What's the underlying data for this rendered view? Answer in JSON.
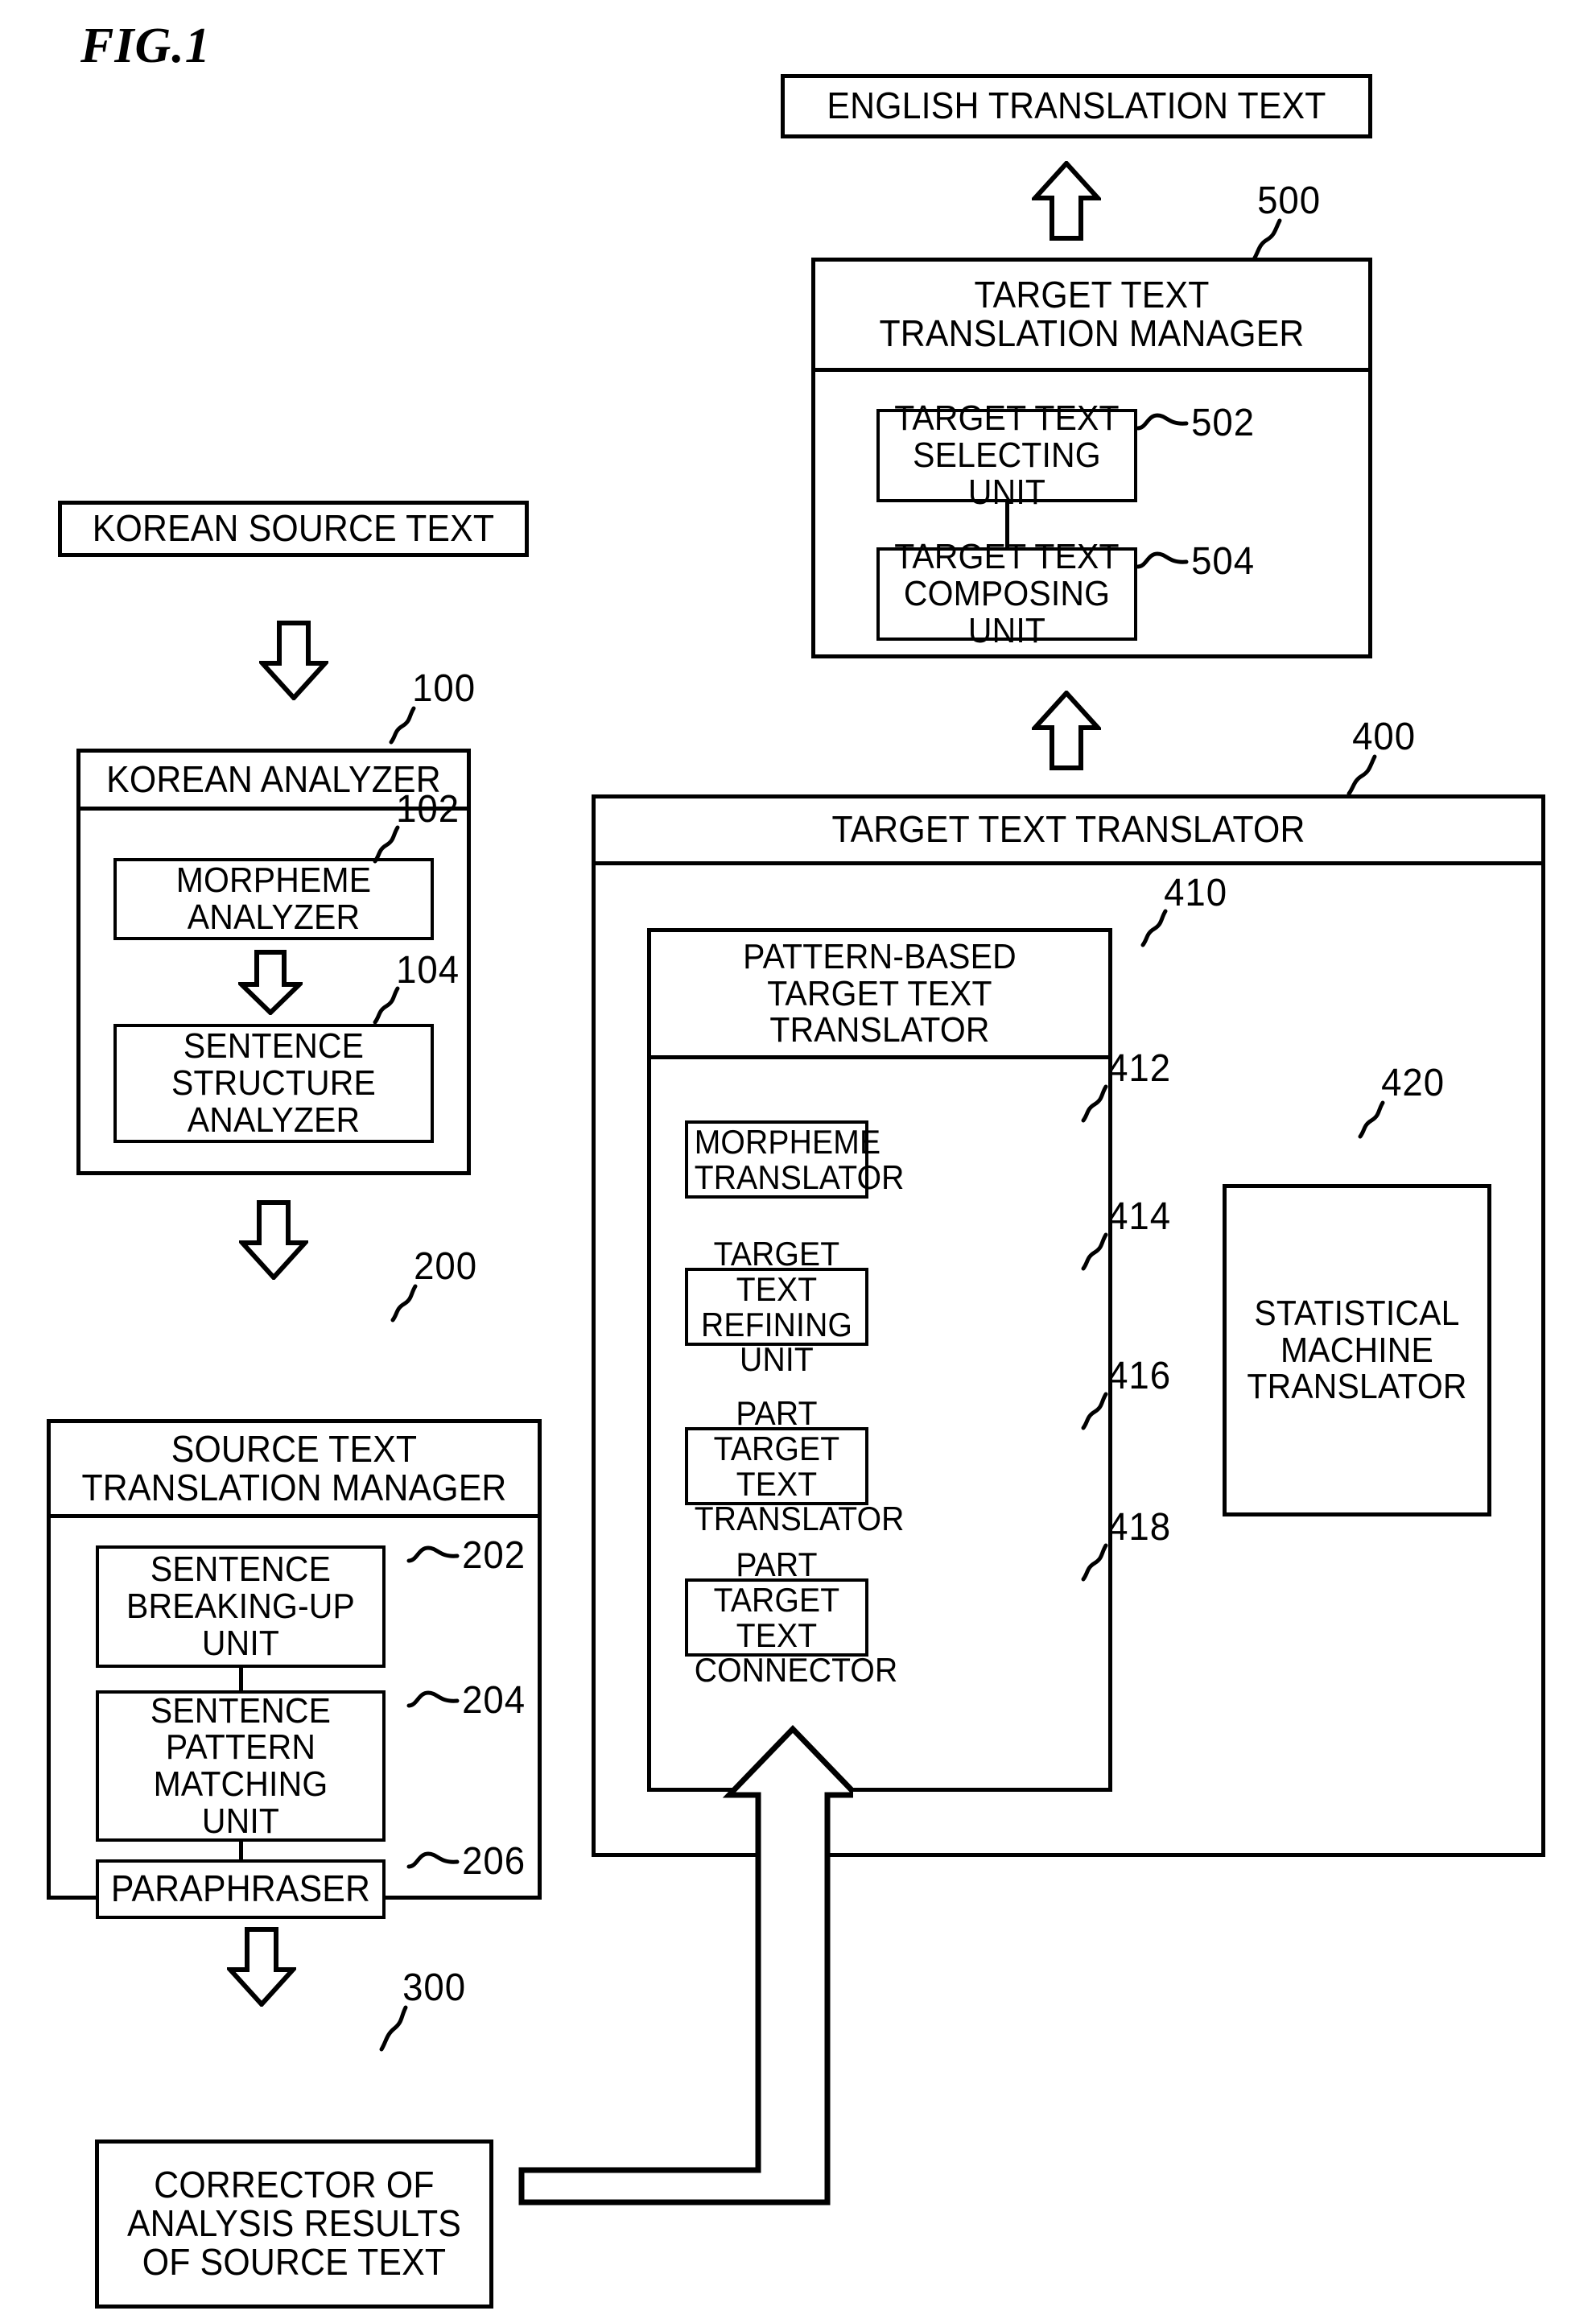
{
  "figure": {
    "title": "FIG.1"
  },
  "nodes": {
    "english_translation_text": "ENGLISH TRANSLATION TEXT",
    "target_text_translation_manager": "TARGET TEXT\nTRANSLATION MANAGER",
    "target_text_selecting_unit": "TARGET TEXT\nSELECTING UNIT",
    "target_text_composing_unit": "TARGET TEXT\nCOMPOSING UNIT",
    "target_text_translator": "TARGET TEXT TRANSLATOR",
    "pattern_based_target_text_translator": "PATTERN-BASED\nTARGET TEXT\nTRANSLATOR",
    "morpheme_translator": "MORPHEME\nTRANSLATOR",
    "target_text_refining_unit": "TARGET TEXT\nREFINING UNIT",
    "part_target_text_translator": "PART TARGET\nTEXT TRANSLATOR",
    "part_target_text_connector": "PART TARGET\nTEXT CONNECTOR",
    "statistical_machine_translator": "STATISTICAL\nMACHINE\nTRANSLATOR",
    "korean_source_text": "KOREAN SOURCE TEXT",
    "korean_analyzer": "KOREAN ANALYZER",
    "morpheme_analyzer": "MORPHEME\nANALYZER",
    "sentence_structure_analyzer": "SENTENCE\nSTRUCTURE\nANALYZER",
    "source_text_translation_manager": "SOURCE TEXT\nTRANSLATION MANAGER",
    "sentence_breaking_up_unit": "SENTENCE\nBREAKING-UP\nUNIT",
    "sentence_pattern_matching_unit": "SENTENCE\nPATTERN\nMATCHING\nUNIT",
    "paraphraser": "PARAPHRASER",
    "corrector_of_analysis_results": "CORRECTOR OF\nANALYSIS RESULTS\nOF SOURCE TEXT"
  },
  "reference_numerals": {
    "n100": "100",
    "n102": "102",
    "n104": "104",
    "n200": "200",
    "n202": "202",
    "n204": "204",
    "n206": "206",
    "n300": "300",
    "n400": "400",
    "n410": "410",
    "n412": "412",
    "n414": "414",
    "n416": "416",
    "n418": "418",
    "n420": "420",
    "n500": "500",
    "n502": "502",
    "n504": "504"
  },
  "colors": {
    "stroke": "#000000",
    "background": "#ffffff"
  }
}
